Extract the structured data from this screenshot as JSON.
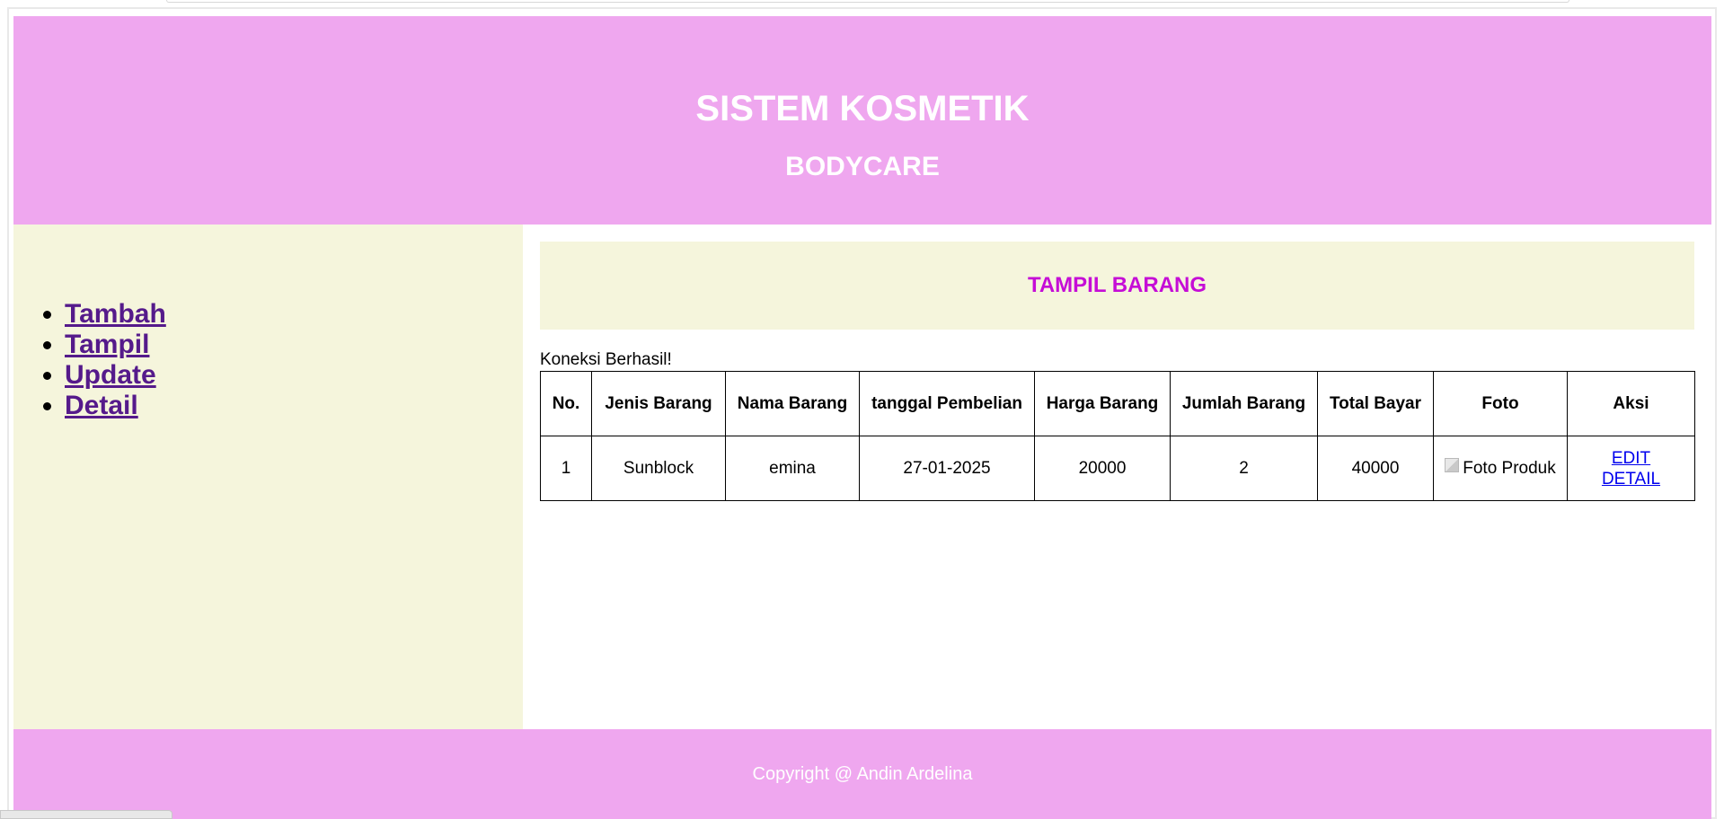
{
  "header": {
    "title": "SISTEM KOSMETIK",
    "subtitle": "BODYCARE"
  },
  "sidebar": {
    "items": [
      {
        "label": "Tambah"
      },
      {
        "label": "Tampil"
      },
      {
        "label": "Update"
      },
      {
        "label": "Detail"
      }
    ]
  },
  "main": {
    "heading": "TAMPIL BARANG",
    "connection_message": "Koneksi Berhasil!",
    "table": {
      "columns": [
        "No.",
        "Jenis Barang",
        "Nama Barang",
        "tanggal Pembelian",
        "Harga Barang",
        "Jumlah Barang",
        "Total Bayar",
        "Foto",
        "Aksi"
      ],
      "rows": [
        {
          "no": "1",
          "jenis": "Sunblock",
          "nama": "emina",
          "tanggal": "27-01-2025",
          "harga": "20000",
          "jumlah": "2",
          "total": "40000",
          "foto_alt": "Foto Produk",
          "aksi_edit": "EDIT",
          "aksi_detail": "DETAIL"
        }
      ]
    }
  },
  "footer": {
    "copyright": "Copyright @ Andin Ardelina"
  },
  "colors": {
    "header_bg": "#efa7ef",
    "sidebar_bg": "#f5f5dc",
    "heading_text": "#c50dd6"
  }
}
